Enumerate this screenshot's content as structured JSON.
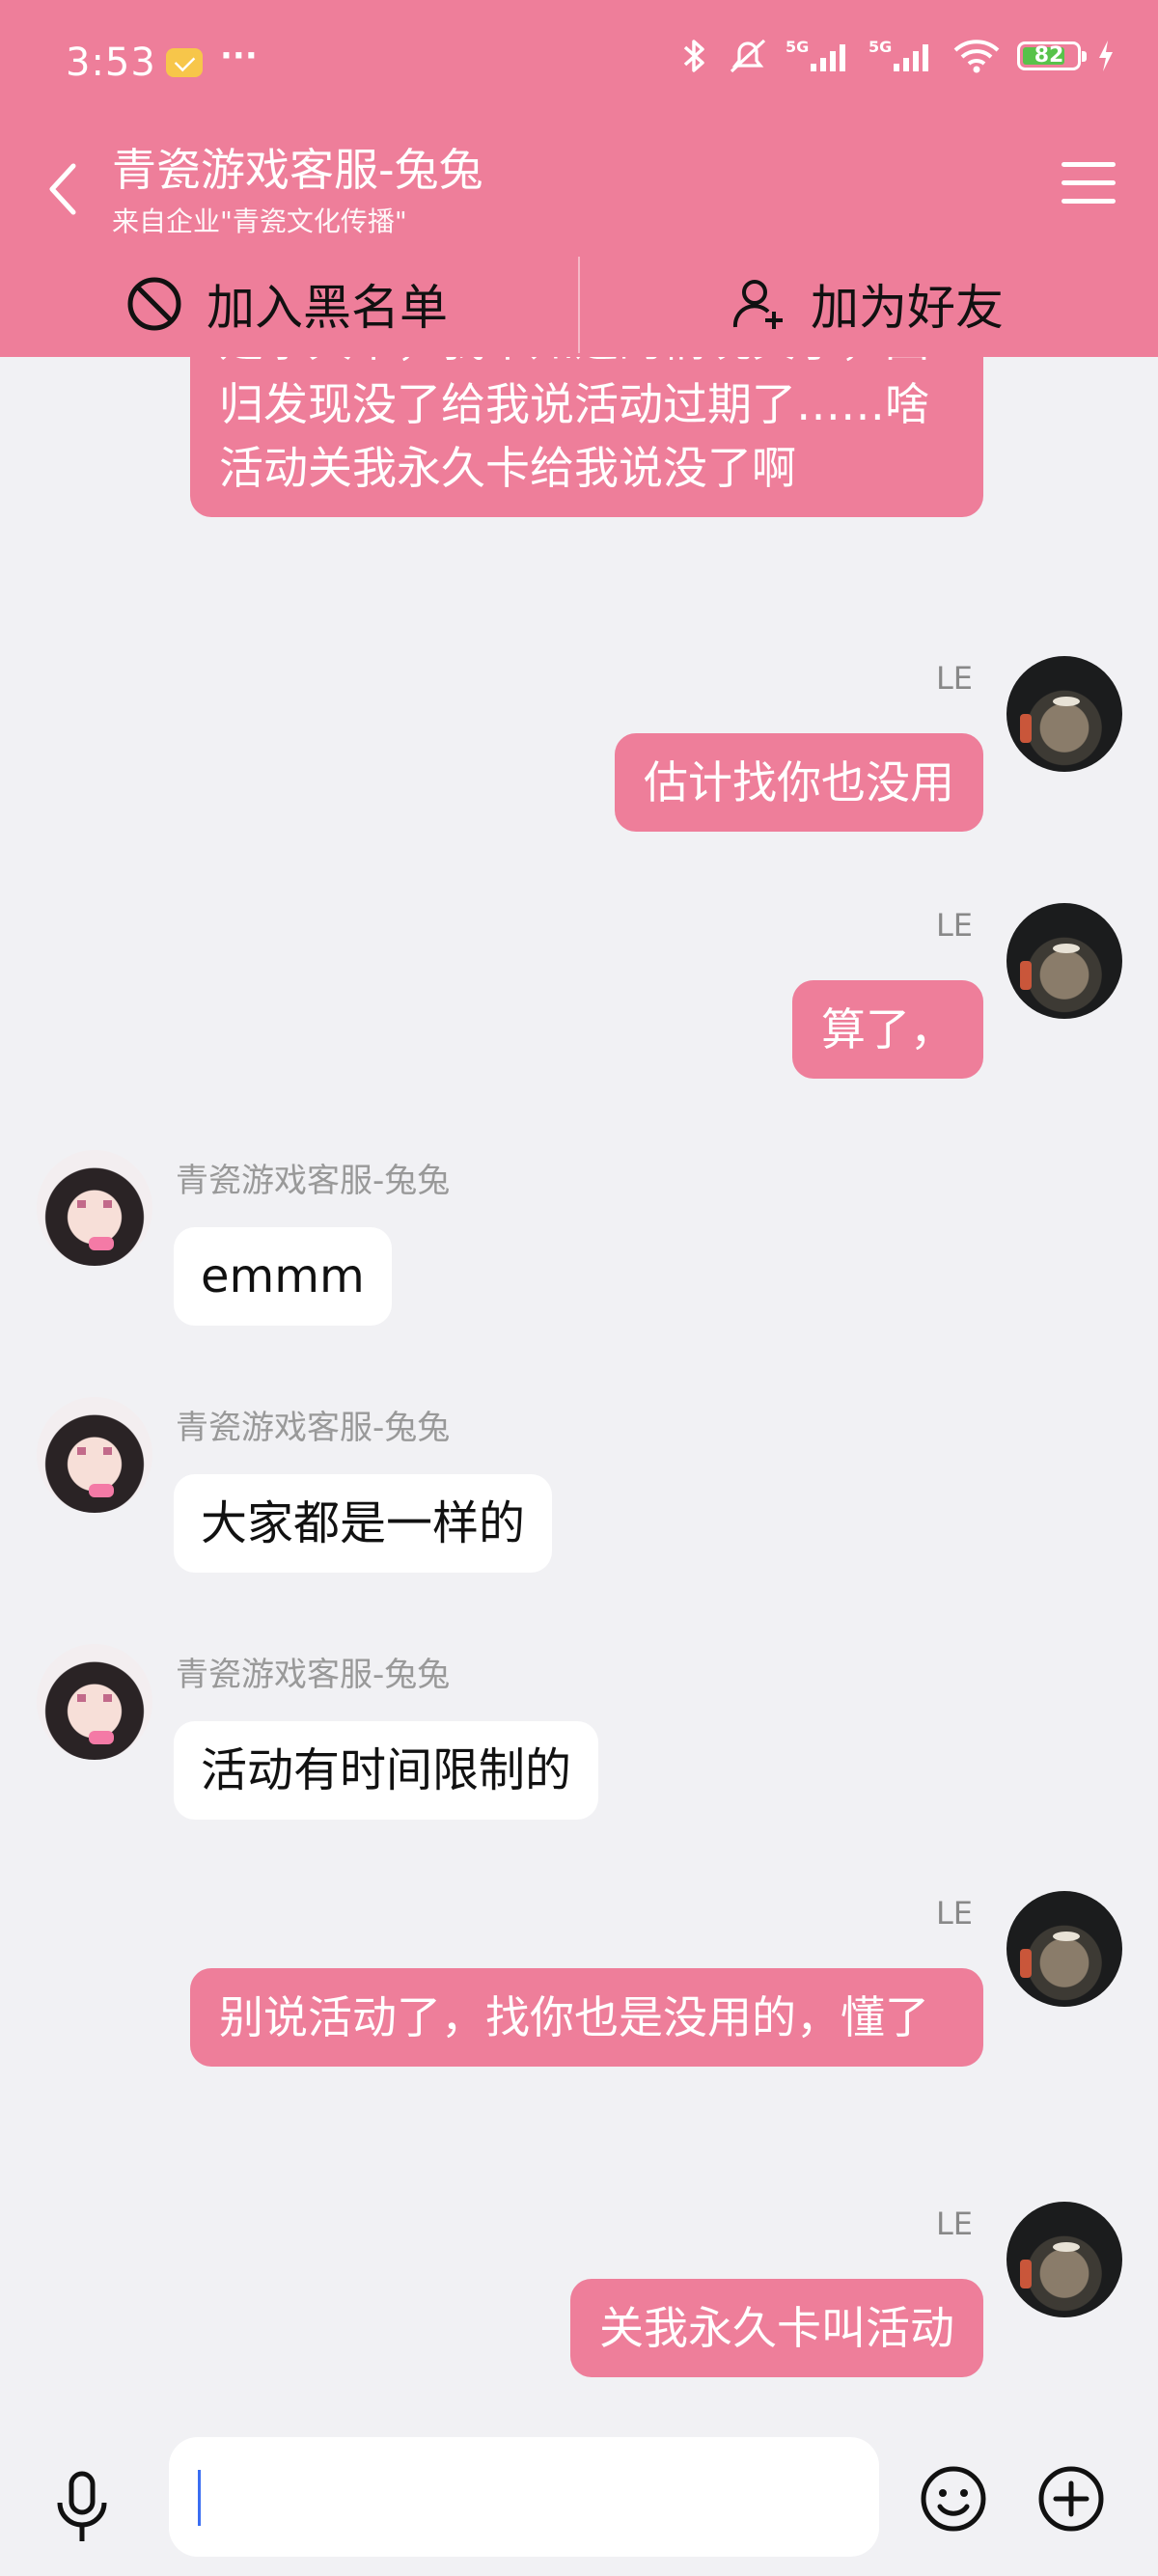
{
  "status_bar": {
    "time": "3:53",
    "dots": "···",
    "battery": "82",
    "network": "5G"
  },
  "header": {
    "title": "青瓷游戏客服-兔兔",
    "subtitle": "来自企业\"青瓷文化传播\""
  },
  "actions": {
    "block": "加入黑名单",
    "add_friend": "加为好友"
  },
  "messages": [
    {
      "side": "right",
      "text": "是永久卡，我不知道的情况关了，回归发现没了给我说活动过期了……啥活动关我永久卡给我说没了啊"
    },
    {
      "side": "right",
      "sender": "LE",
      "text": "估计找你也没用"
    },
    {
      "side": "right",
      "sender": "LE",
      "text": "算了，"
    },
    {
      "side": "left",
      "sender": "青瓷游戏客服-兔兔",
      "text": "emmm"
    },
    {
      "side": "left",
      "sender": "青瓷游戏客服-兔兔",
      "text": "大家都是一样的"
    },
    {
      "side": "left",
      "sender": "青瓷游戏客服-兔兔",
      "text": "活动有时间限制的"
    },
    {
      "side": "right",
      "sender": "LE",
      "text": "别说活动了，找你也是没用的，懂了"
    },
    {
      "side": "right",
      "sender": "LE",
      "text": "关我永久卡叫活动"
    }
  ],
  "colors": {
    "accent": "#ee7e9a",
    "background": "#f1f1f4"
  }
}
